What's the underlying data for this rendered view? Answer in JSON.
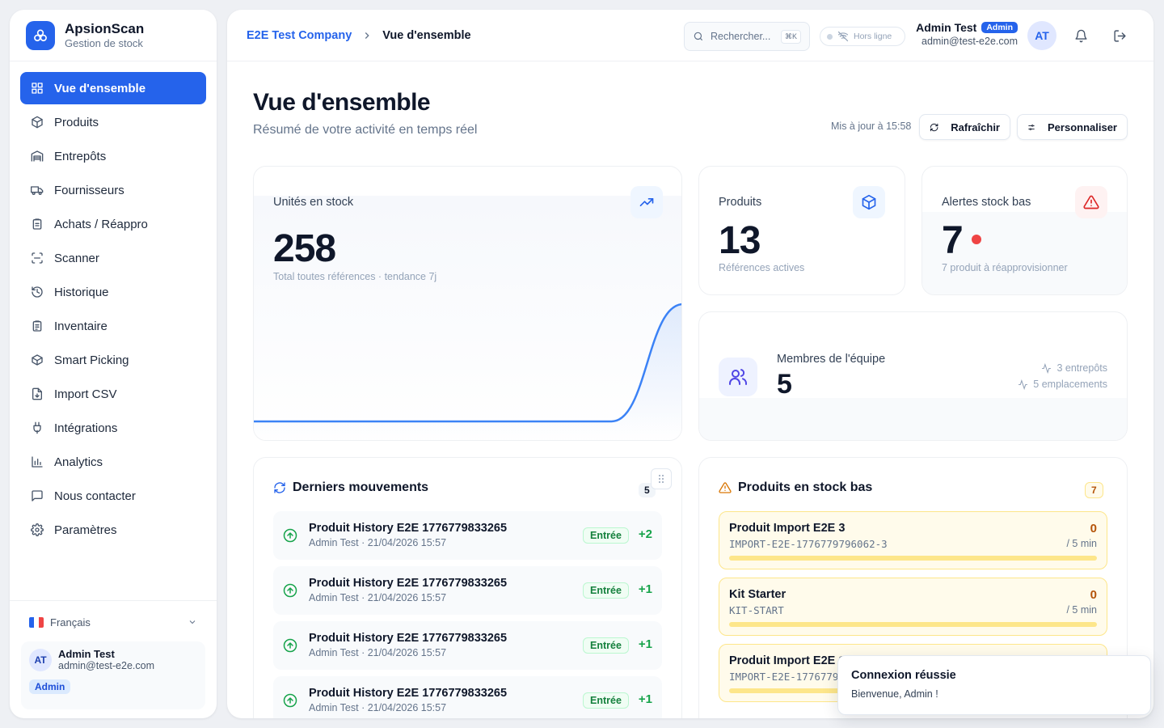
{
  "brand": {
    "name": "ApsionScan",
    "subtitle": "Gestion de stock"
  },
  "sidebar": {
    "items": [
      {
        "label": "Vue d'ensemble",
        "icon": "layout-grid-icon",
        "active": true
      },
      {
        "label": "Produits",
        "icon": "package-icon"
      },
      {
        "label": "Entrepôts",
        "icon": "warehouse-icon"
      },
      {
        "label": "Fournisseurs",
        "icon": "truck-icon"
      },
      {
        "label": "Achats / Réappro",
        "icon": "clipboard-icon"
      },
      {
        "label": "Scanner",
        "icon": "scan-icon"
      },
      {
        "label": "Historique",
        "icon": "history-icon"
      },
      {
        "label": "Inventaire",
        "icon": "clipboard-list-icon"
      },
      {
        "label": "Smart Picking",
        "icon": "box-icon"
      },
      {
        "label": "Import CSV",
        "icon": "file-import-icon"
      },
      {
        "label": "Intégrations",
        "icon": "plug-icon"
      },
      {
        "label": "Analytics",
        "icon": "bar-chart-icon"
      },
      {
        "label": "Nous contacter",
        "icon": "message-icon"
      },
      {
        "label": "Paramètres",
        "icon": "settings-icon"
      }
    ],
    "language": "Français",
    "user": {
      "initials": "AT",
      "name": "Admin Test",
      "email": "admin@test-e2e.com",
      "role": "Admin"
    }
  },
  "topbar": {
    "breadcrumb": {
      "company": "E2E Test Company",
      "current": "Vue d'ensemble"
    },
    "search_placeholder": "Rechercher...",
    "search_shortcut": "⌘K",
    "status": "Hors ligne",
    "user": {
      "name": "Admin Test",
      "role": "Admin",
      "email": "admin@test-e2e.com",
      "initials": "AT"
    }
  },
  "header": {
    "title": "Vue d'ensemble",
    "subtitle": "Résumé de votre activité en temps réel",
    "updated": "Mis à jour à 15:58",
    "refresh_label": "Rafraîchir",
    "customize_label": "Personnaliser"
  },
  "stats": {
    "units": {
      "label": "Unités en stock",
      "value": "258",
      "note": "Total toutes références · tendance 7j"
    },
    "products": {
      "label": "Produits",
      "value": "13",
      "note": "Références actives"
    },
    "alerts": {
      "label": "Alertes stock bas",
      "value": "7",
      "note": "7 produit à réapprovisionner"
    },
    "team": {
      "label": "Membres de l'équipe",
      "value": "5",
      "warehouses": "3 entrepôts",
      "locations": "5 emplacements"
    }
  },
  "chart_data": {
    "type": "area",
    "series": [
      {
        "values": [
          0,
          0,
          0,
          0,
          0,
          0,
          258
        ]
      }
    ]
  },
  "movements": {
    "title": "Derniers mouvements",
    "count": "5",
    "rows": [
      {
        "product": "Produit History E2E 1776779833265",
        "meta": "Admin Test · 21/04/2026 15:57",
        "type": "Entrée",
        "qty": "+2"
      },
      {
        "product": "Produit History E2E 1776779833265",
        "meta": "Admin Test · 21/04/2026 15:57",
        "type": "Entrée",
        "qty": "+1"
      },
      {
        "product": "Produit History E2E 1776779833265",
        "meta": "Admin Test · 21/04/2026 15:57",
        "type": "Entrée",
        "qty": "+1"
      },
      {
        "product": "Produit History E2E 1776779833265",
        "meta": "Admin Test · 21/04/2026 15:57",
        "type": "Entrée",
        "qty": "+1"
      }
    ]
  },
  "low_stock": {
    "title": "Produits en stock bas",
    "count": "7",
    "rows": [
      {
        "name": "Produit Import E2E 3",
        "sku": "IMPORT-E2E-1776779796062-3",
        "qty": "0",
        "min": "/ 5 min"
      },
      {
        "name": "Kit Starter",
        "sku": "KIT-START",
        "qty": "0",
        "min": "/ 5 min"
      },
      {
        "name": "Produit Import E2E 1",
        "sku": "IMPORT-E2E-17767797",
        "qty": "",
        "min": ""
      }
    ]
  },
  "toast": {
    "title": "Connexion réussie",
    "message": "Bienvenue, Admin !"
  },
  "colors": {
    "accent": "#2563eb",
    "success": "#16a34a",
    "warning": "#b45309",
    "danger": "#dc2626"
  }
}
